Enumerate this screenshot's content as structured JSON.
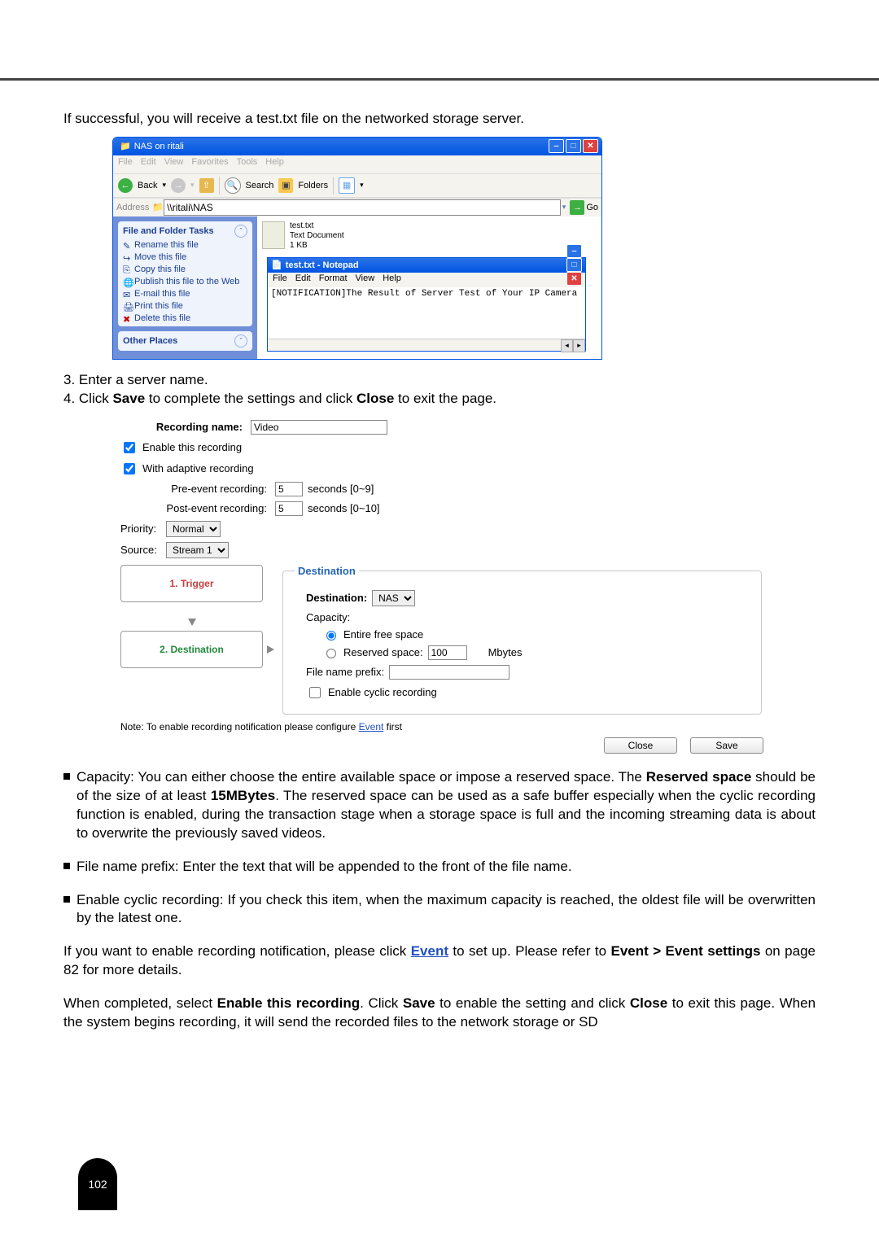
{
  "intro": "If successful, you will receive a test.txt file on the networked storage server.",
  "explorer": {
    "title": "NAS on ritali",
    "menu": [
      "File",
      "Edit",
      "View",
      "Favorites",
      "Tools",
      "Help"
    ],
    "back": "Back",
    "search": "Search",
    "folders": "Folders",
    "addressLabel": "Address",
    "addressValue": "\\\\ritali\\NAS",
    "go": "Go",
    "sidebar1_title": "File and Folder Tasks",
    "side_items": [
      "Rename this file",
      "Move this file",
      "Copy this file",
      "Publish this file to the Web",
      "E-mail this file",
      "Print this file",
      "Delete this file"
    ],
    "sidebar2_title": "Other Places",
    "file_name": "test.txt",
    "file_type": "Text Document",
    "file_size": "1 KB"
  },
  "notepad": {
    "title": "test.txt - Notepad",
    "menu": [
      "File",
      "Edit",
      "Format",
      "View",
      "Help"
    ],
    "content": "[NOTIFICATION]The Result of Server Test of Your IP Camera"
  },
  "step3": "3. Enter a server name.",
  "step4_a": "4. Click ",
  "step4_b": "Save",
  "step4_c": " to complete the settings and click ",
  "step4_d": "Close",
  "step4_e": " to exit the page.",
  "rec": {
    "nameLbl": "Recording name:",
    "nameVal": "Video",
    "enable": "Enable this recording",
    "adaptive": "With adaptive recording",
    "preLbl": "Pre-event recording:",
    "preVal": "5",
    "preUnit": "seconds [0~9]",
    "postLbl": "Post-event recording:",
    "postVal": "5",
    "postUnit": "seconds [0~10]",
    "priorityLbl": "Priority:",
    "priorityVal": "Normal",
    "sourceLbl": "Source:",
    "sourceVal": "Stream 1",
    "step1": "1.  Trigger",
    "step2": "2.  Destination",
    "destLegend": "Destination",
    "destinationLbl": "Destination:",
    "destinationVal": "NAS",
    "capacityLbl": "Capacity:",
    "entire": "Entire free space",
    "reserved": "Reserved space:",
    "reservedVal": "100",
    "reservedUnit": "Mbytes",
    "prefixLbl": "File name prefix:",
    "prefixVal": "",
    "cyclic": "Enable cyclic recording",
    "note_a": "Note: To enable recording notification please configure ",
    "note_link": "Event",
    "note_b": " first",
    "closeBtn": "Close",
    "saveBtn": "Save"
  },
  "bullets": {
    "cap": "Capacity: You can either choose the entire available space or impose a reserved space. The Reserved space should be of the size of at least 15MBytes. The reserved space can be used as a safe buffer especially when the cyclic recording function is enabled, during the transaction stage when a storage space is full and the incoming streaming data is about to overwrite the previously saved videos.",
    "prefix": "File name prefix: Enter the text that will be appended to the front of the file name.",
    "cyclic": "Enable cyclic recording: If you check this item, when the maximum capacity is reached, the oldest file will be overwritten by the latest one."
  },
  "para_event_a": "If you want to enable recording notification, please click ",
  "para_event_link": "Event",
  "para_event_b": " to set up. Please refer to ",
  "para_event_c": "Event > Event settings",
  "para_event_d": " on page 82 for more details.",
  "para_done_a": "When completed, select ",
  "para_done_b": "Enable this recording",
  "para_done_c": ". Click ",
  "para_done_d": "Save",
  "para_done_e": " to enable the setting and click ",
  "para_done_f": "Close",
  "para_done_g": " to exit this page. When the system begins recording, it will send the recorded files to the network storage or SD",
  "pagenum": "102"
}
